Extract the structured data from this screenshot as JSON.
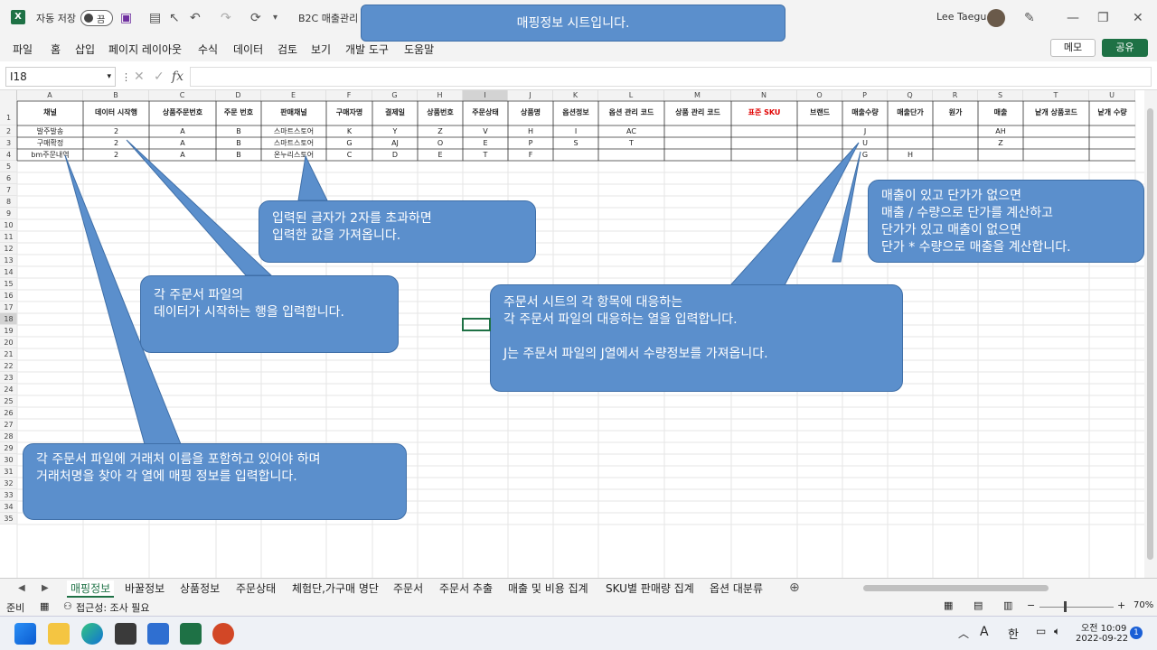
{
  "titlebar": {
    "autosave_label": "자동 저장",
    "autosave_state": "끔",
    "file_name": "B2C 매출관리 ㅅ",
    "user_name": "Lee Taegu"
  },
  "menu": [
    "파일",
    "홈",
    "삽입",
    "페이지 레이아웃",
    "수식",
    "데이터",
    "검토",
    "보기",
    "개발 도구",
    "도움말"
  ],
  "buttons": {
    "memo": "메모",
    "share": "공유"
  },
  "formula_bar": {
    "name_box": "I18",
    "fx": "fx",
    "value": ""
  },
  "columns": [
    "A",
    "B",
    "C",
    "D",
    "E",
    "F",
    "G",
    "H",
    "I",
    "J",
    "K",
    "L",
    "M",
    "N",
    "O",
    "P",
    "Q",
    "R",
    "S",
    "T",
    "U"
  ],
  "header_row": [
    "채널",
    "데이터 시작행",
    "상품주문번호",
    "주문 번호",
    "판매채널",
    "구매자명",
    "결제일",
    "상품번호",
    "주문상태",
    "상품명",
    "옵션정보",
    "옵션 관리 코드",
    "상품 관리 코드",
    "표준 SKU",
    "브랜드",
    "매출수량",
    "매출단가",
    "원가",
    "매출",
    "낱개 상품코드",
    "낱개 수량"
  ],
  "rows": [
    [
      "발주발송",
      "2",
      "A",
      "B",
      "스마트스토어",
      "K",
      "Y",
      "Z",
      "V",
      "H",
      "I",
      "AC",
      "",
      "",
      "",
      "J",
      "",
      "",
      "AH",
      "",
      ""
    ],
    [
      "구매확정",
      "2",
      "A",
      "B",
      "스마트스토어",
      "G",
      "AJ",
      "O",
      "E",
      "P",
      "S",
      "T",
      "",
      "",
      "",
      "U",
      "",
      "",
      "Z",
      "",
      ""
    ],
    [
      "bm주문내역",
      "2",
      "A",
      "B",
      "온누리스토어",
      "C",
      "D",
      "E",
      "T",
      "F",
      "",
      "",
      "",
      "",
      "",
      "G",
      "H",
      "",
      "",
      "",
      ""
    ]
  ],
  "row_numbers": [
    "1",
    "2",
    "3",
    "4",
    "5",
    "6",
    "7",
    "8",
    "9",
    "10",
    "11",
    "12",
    "13",
    "14",
    "15",
    "16",
    "17",
    "18",
    "19",
    "20",
    "21",
    "22",
    "23",
    "24",
    "25",
    "26",
    "27",
    "28",
    "29",
    "30",
    "31",
    "32",
    "33",
    "34",
    "35"
  ],
  "callouts": {
    "top": "매핑정보 시트입니다.",
    "text_len": [
      "입력된 글자가 2자를 초과하면",
      "입력한 값을 가져옵니다."
    ],
    "start_row": [
      "각 주문서 파일의",
      "데이터가 시작하는 행을 입력합니다."
    ],
    "price": [
      "매출이 있고 단가가 없으면",
      "매출 / 수량으로 단가를 계산하고",
      "단가가 있고 매출이 없으면",
      "단가 * 수량으로 매출을 계산합니다."
    ],
    "mapping": [
      "주문서 시트의 각 항목에 대응하는",
      "각 주문서 파일의 대응하는 열을 입력합니다.",
      "",
      "J는 주문서 파일의 J열에서 수량정보를 가져옵니다."
    ],
    "vendor": [
      "각 주문서 파일에 거래처 이름을 포함하고 있어야 하며",
      "거래처명을 찾아 각 열에 매핑 정보를 입력합니다."
    ]
  },
  "sheet_tabs": [
    "매핑정보",
    "바꿀정보",
    "상품정보",
    "주문상태",
    "체험단,가구매 명단",
    "주문서",
    "주문서 추출",
    "매출 및 비용 집계",
    "SKU별 판매량 집계",
    "옵션 대분류"
  ],
  "status": {
    "ready": "준비",
    "accessibility": "접근성: 조사 필요",
    "zoom": "70%"
  },
  "clock": {
    "time": "오전 10:09",
    "date": "2022-09-22"
  },
  "tray": {
    "ime_a": "A",
    "ime_han": "한",
    "notif": "1"
  },
  "colors": {
    "excel_green": "#1e7145",
    "callout": "#5b8fcc",
    "red": "#e00000"
  }
}
